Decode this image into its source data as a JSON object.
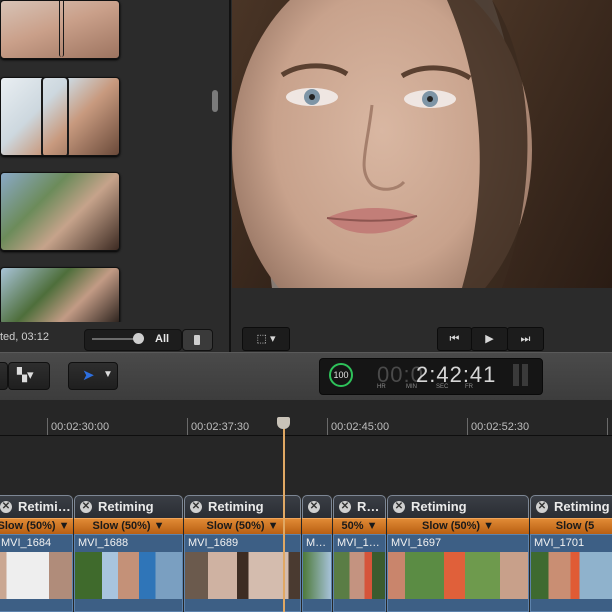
{
  "browser": {
    "status_text": "ted, 03:12",
    "zoom_all_label": "All"
  },
  "timecode": {
    "percent": "100",
    "dim_digits": "00:0",
    "value": "2:42:41",
    "units": [
      "HR",
      "MIN",
      "SEC",
      "FR"
    ]
  },
  "ruler": {
    "ticks": [
      "00:02:30:00",
      "00:02:37:30",
      "00:02:45:00",
      "00:02:52:30"
    ]
  },
  "clips": [
    {
      "retime": "Retimi…",
      "speed": "Slow (50%) ▼",
      "name": "MVI_1684"
    },
    {
      "retime": "Retiming",
      "speed": "Slow (50%) ▼",
      "name": "MVI_1688"
    },
    {
      "retime": "Retiming",
      "speed": "Slow (50%) ▼",
      "name": "MVI_1689"
    },
    {
      "retime": "",
      "speed": "",
      "name": "M…"
    },
    {
      "retime": "R…",
      "speed": "50% ▼",
      "name": "MVI_1…"
    },
    {
      "retime": "Retiming",
      "speed": "Slow (50%) ▼",
      "name": "MVI_1697"
    },
    {
      "retime": "Retiming",
      "speed": "Slow (5",
      "name": "MVI_1701"
    }
  ],
  "colors": {
    "accent_blue": "#2d6fe0",
    "retime_orange": "#d37a2a",
    "clip_blue": "#3d5f85",
    "playhead": "#e0a864",
    "render_green": "#2ec25a"
  }
}
